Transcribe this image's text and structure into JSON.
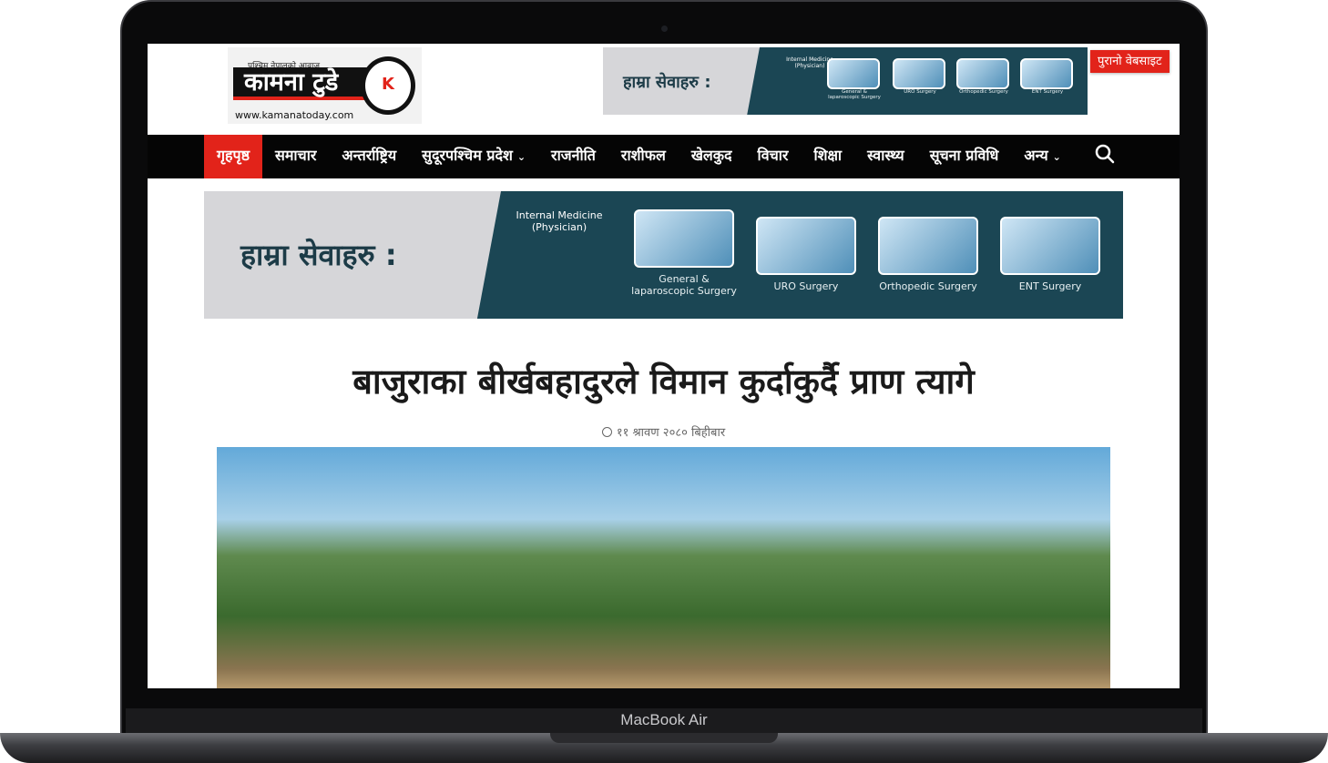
{
  "device": {
    "label": "MacBook Air"
  },
  "header": {
    "logo": {
      "tagline": "पश्चिम नेपालको आवाज",
      "name": "कामना टुडे",
      "url": "www.kamanatoday.com",
      "badge": "K"
    },
    "old_site_button": "पुरानो वेबसाइट"
  },
  "ads": {
    "heading": "हाम्रा सेवाहरु :",
    "internal_medicine": "Internal Medicine (Physician)",
    "services": [
      "General & laparoscopic Surgery",
      "URO Surgery",
      "Orthopedic Surgery",
      "ENT Surgery"
    ]
  },
  "nav": {
    "items": [
      "गृहपृष्ठ",
      "समाचार",
      "अन्तर्राष्ट्रिय",
      "सुदूरपश्चिम प्रदेश",
      "राजनीति",
      "राशीफल",
      "खेलकुद",
      "विचार",
      "शिक्षा",
      "स्वास्थ्य",
      "सूचना प्रविधि",
      "अन्य"
    ],
    "search_icon": "search-icon"
  },
  "article": {
    "title": "बाजुराका बीर्खबहादुरले विमान कुर्दाकुर्दै प्राण त्यागे",
    "date": "११ श्रावण २०८० बिहीबार"
  },
  "colors": {
    "accent": "#e2231a",
    "nav_bg": "#050505",
    "ad_bg": "#1b4654"
  }
}
